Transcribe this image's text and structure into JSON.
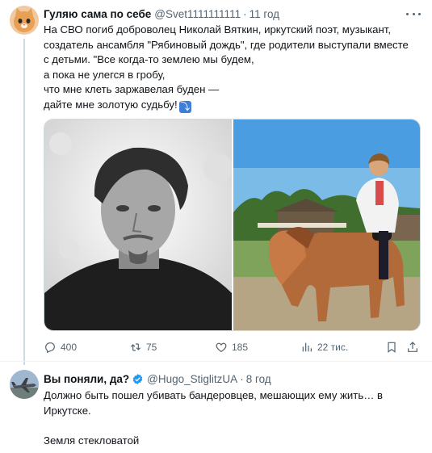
{
  "tweet1": {
    "author_name": "Гуляю сама по себе",
    "author_handle": "@Svet1111111111",
    "time": "11 год",
    "text_lines": [
      "На СВО погиб доброволец Николай Вяткин, иркутский поэт, музыкант,",
      "создатель ансамбля \"Рябиновый дождь\", где родители выступали вместе",
      "с детьми. \"Все когда-то землею мы будем,",
      "а пока не улегся в гробу,",
      "что мне клеть заржавелая буден —",
      "дайте мне золотую судьбу!"
    ],
    "emoji": "⤵",
    "stats": {
      "replies": "400",
      "retweets": "75",
      "likes": "185",
      "views": "22 тис."
    }
  },
  "tweet2": {
    "author_name": "Вы поняли, да?",
    "author_handle": "@Hugo_StiglitzUA",
    "time": "8 год",
    "text_lines": [
      "Должно быть пошел убивать бандеровцев, мешающих ему жить… в",
      "Иркутске.",
      "",
      "Земля стекловатой"
    ]
  },
  "colors": {
    "text": "#0f1419",
    "secondary": "#536471",
    "verified_blue": "#1d9bf0",
    "divider": "#eff3f4"
  },
  "icons": [
    "reply-icon",
    "retweet-icon",
    "like-icon",
    "views-icon",
    "bookmark-icon",
    "share-icon",
    "more-icon",
    "verified-icon"
  ]
}
